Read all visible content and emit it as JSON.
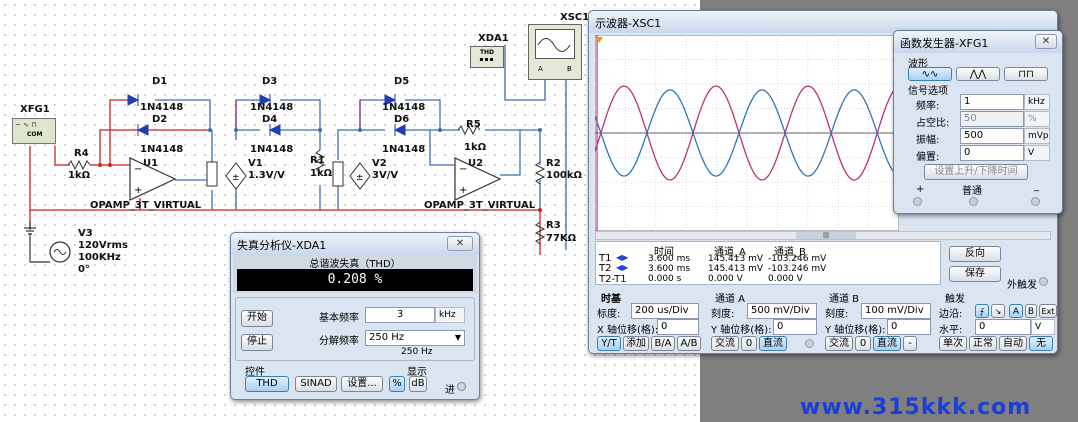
{
  "circuit": {
    "xfg_label": "XFG1",
    "com_label": "COM",
    "r4": {
      "name": "R4",
      "value": "1kΩ"
    },
    "u1": "U1",
    "u2": "U2",
    "opamp_label": "OPAMP_3T_VIRTUAL",
    "diodes": [
      {
        "name": "D1",
        "part": "1N4148"
      },
      {
        "name": "D2",
        "part": "1N4148"
      },
      {
        "name": "D3",
        "part": "1N4148"
      },
      {
        "name": "D4",
        "part": "1N4148"
      },
      {
        "name": "D5",
        "part": "1N4148"
      },
      {
        "name": "D6",
        "part": "1N4148"
      }
    ],
    "v1": {
      "name": "V1",
      "value": "1.3V/V"
    },
    "r1": {
      "name": "R1",
      "value": "1kΩ"
    },
    "v2": {
      "name": "V2",
      "value": "3V/V"
    },
    "r5": {
      "name": "R5",
      "value": "1kΩ"
    },
    "r2": {
      "name": "R2",
      "value": "100kΩ"
    },
    "r3": {
      "name": "R3",
      "value": "77KΩ"
    },
    "v3": {
      "name": "V3",
      "vrms": "120Vrms",
      "freq": "100KHz",
      "phase": "0°"
    },
    "xda": {
      "name": "XDA1",
      "body": "THD"
    },
    "xsc": {
      "name": "XSC1",
      "a": "A",
      "b": "B"
    }
  },
  "distortion": {
    "title": "失真分析仪-XDA1",
    "close": "✕",
    "section_title": "总谐波失真（THD）",
    "value": "0.208 %",
    "start": "开始",
    "stop": "停止",
    "fund_label": "基本频率",
    "fund_value": "3",
    "fund_unit": "kHz",
    "res_label": "分解频率",
    "res_value": "250 Hz",
    "res_sub": "250 Hz",
    "controls_label": "控件",
    "display_label": "显示",
    "thd_btn": "THD",
    "sinad_btn": "SINAD",
    "settings_btn": "设置...",
    "pct_btn": "%",
    "db_btn": "dB",
    "in_label": "进"
  },
  "scope": {
    "title": "示波器-XSC1",
    "table": {
      "headers": [
        "时间",
        "通道_A",
        "通道_B"
      ],
      "rows": [
        {
          "label": "T1",
          "time": "3.600 ms",
          "a": "145.413 mV",
          "b": "-103.246 mV"
        },
        {
          "label": "T2",
          "time": "3.600 ms",
          "a": "145.413 mV",
          "b": "-103.246 mV"
        },
        {
          "label": "T2-T1",
          "time": "0.000 s",
          "a": "0.000 V",
          "b": "0.000 V"
        }
      ]
    },
    "reverse_btn": "反向",
    "save_btn": "保存",
    "ext_trigger": "外触发",
    "timebase": {
      "title": "时基",
      "scale_label": "标度:",
      "scale": "200 us/Div",
      "xpos_label": "X 轴位移(格):",
      "xpos": "0",
      "modes": [
        "Y/T",
        "添加",
        "B/A",
        "A/B"
      ]
    },
    "chA": {
      "title": "通道 A",
      "scale_label": "刻度:",
      "scale": "500 mV/Div",
      "pos_label": "Y 轴位移(格):",
      "pos": "0",
      "modes": [
        "交流",
        "0",
        "直流"
      ]
    },
    "chB": {
      "title": "通道 B",
      "scale_label": "刻度:",
      "scale": "100 mV/Div",
      "pos_label": "Y 轴位移(格):",
      "pos": "0",
      "modes": [
        "交流",
        "0",
        "直流",
        "-"
      ]
    },
    "trigger": {
      "title": "触发",
      "edge_label": "边沿:",
      "level_label": "水平:",
      "level": "0",
      "level_unit": "V",
      "srcs": [
        "A",
        "B",
        "Ext"
      ],
      "modes": [
        "单次",
        "正常",
        "自动",
        "无"
      ]
    },
    "colors": {
      "a": "#c0307a",
      "b": "#2f76b4"
    },
    "chart_data": {
      "type": "line",
      "series": [
        {
          "name": "A",
          "color": "#c0307a",
          "amplitude": 1.2,
          "phase": 0
        },
        {
          "name": "B",
          "color": "#2f76b4",
          "amplitude": 1.1,
          "phase": 3.14
        }
      ],
      "cycles": 3.3,
      "grid": true
    }
  },
  "fg": {
    "title": "函数发生器-XFG1",
    "close": "✕",
    "wave_label": "波形",
    "options_label": "信号选项",
    "freq_label": "频率:",
    "freq": "1",
    "freq_unit": "kHz",
    "duty_label": "占空比:",
    "duty": "50",
    "duty_unit": "%",
    "amp_label": "振幅:",
    "amp": "500",
    "amp_unit": "mVp",
    "offset_label": "偏置:",
    "offset": "0",
    "offset_unit": "V",
    "rise_btn": "设置上升/下降时间",
    "plus": "+",
    "common": "普通",
    "minus": "_"
  },
  "watermark": "www.315kkk.com",
  "accent": "#1a3fd8"
}
